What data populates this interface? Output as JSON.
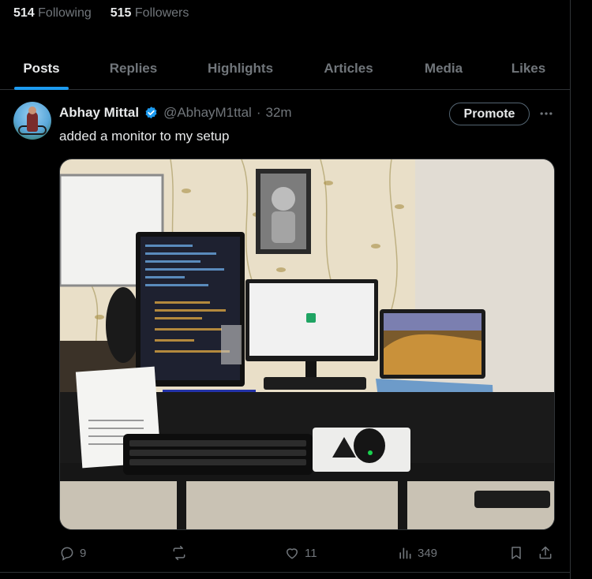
{
  "profile_stats": {
    "following_count": "514",
    "following_label": "Following",
    "followers_count": "515",
    "followers_label": "Followers"
  },
  "tabs": [
    {
      "label": "Posts",
      "active": true
    },
    {
      "label": "Replies",
      "active": false
    },
    {
      "label": "Highlights",
      "active": false
    },
    {
      "label": "Articles",
      "active": false
    },
    {
      "label": "Media",
      "active": false
    },
    {
      "label": "Likes",
      "active": false
    }
  ],
  "tweet": {
    "author_name": "Abhay Mittal",
    "handle": "@AbhayM1ttal",
    "separator": "·",
    "time": "32m",
    "text": "added a monitor to my setup",
    "promote_label": "Promote",
    "stats": {
      "replies": "9",
      "reposts": "",
      "likes": "11",
      "views": "349"
    }
  },
  "colors": {
    "background": "#000000",
    "text_primary": "#e7e9ea",
    "text_secondary": "#71767b",
    "accent": "#1d9bf0",
    "border": "#2f3336"
  },
  "icons": [
    "verified-badge-icon",
    "more-icon",
    "reply-icon",
    "repost-icon",
    "like-icon",
    "views-icon",
    "bookmark-icon",
    "share-icon"
  ]
}
